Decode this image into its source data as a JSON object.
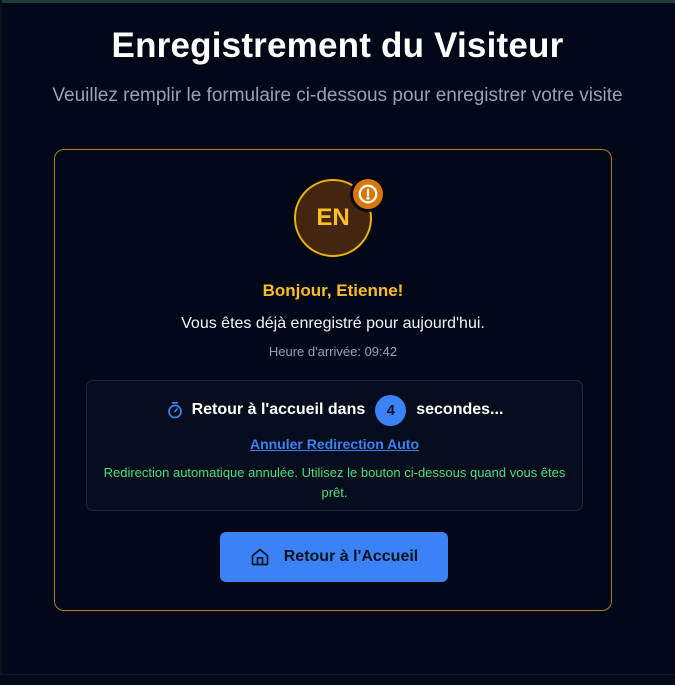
{
  "header": {
    "title": "Enregistrement du Visiteur",
    "subtitle": "Veuillez remplir le formulaire ci-dessous pour enregistrer votre visite"
  },
  "visitor": {
    "initials": "EN",
    "greeting": "Bonjour, Etienne!",
    "message": "Vous êtes déjà enregistré pour aujourd'hui.",
    "arrival": "Heure d'arrivée: 09:42"
  },
  "redirect": {
    "text_before": "Retour à l'accueil dans",
    "count": "4",
    "text_after": "secondes...",
    "cancel_link": "Annuler Redirection Auto",
    "cancel_note": "Redirection automatique annulée. Utilisez le bouton ci-dessous quand vous êtes prêt."
  },
  "actions": {
    "home_button": "Retour à l'Accueil"
  },
  "icons": {
    "alert": "alert-circle-icon",
    "timer": "timer-icon",
    "home": "home-icon"
  },
  "colors": {
    "background": "#020817",
    "accent_gold": "#fbbf24",
    "card_border": "#a67f1c",
    "primary_blue": "#3b82f6",
    "success_green": "#4ade80",
    "badge_orange": "#d97706"
  }
}
